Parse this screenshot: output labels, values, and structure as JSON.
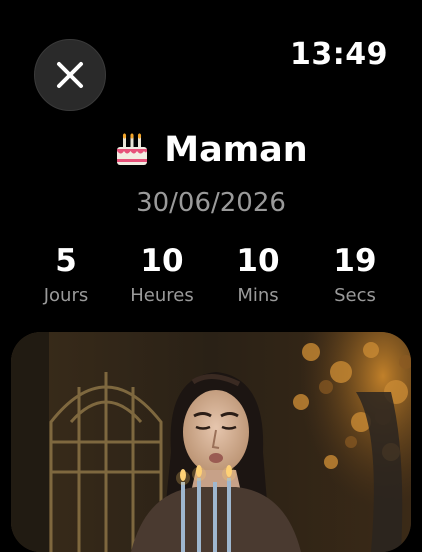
{
  "header": {
    "time": "13:49",
    "close_icon": "close-icon"
  },
  "event": {
    "emoji_icon": "birthday-cake-icon",
    "title": "Maman",
    "date": "30/06/2026"
  },
  "countdown": [
    {
      "value": "5",
      "label": "Jours"
    },
    {
      "value": "10",
      "label": "Heures"
    },
    {
      "value": "10",
      "label": "Mins"
    },
    {
      "value": "19",
      "label": "Secs"
    }
  ],
  "photo": {
    "subject": "woman-blowing-birthday-candles"
  },
  "colors": {
    "background": "#000000",
    "text_primary": "#ffffff",
    "text_secondary": "#9a9a9a",
    "button_bg": "#2a2a2a"
  }
}
